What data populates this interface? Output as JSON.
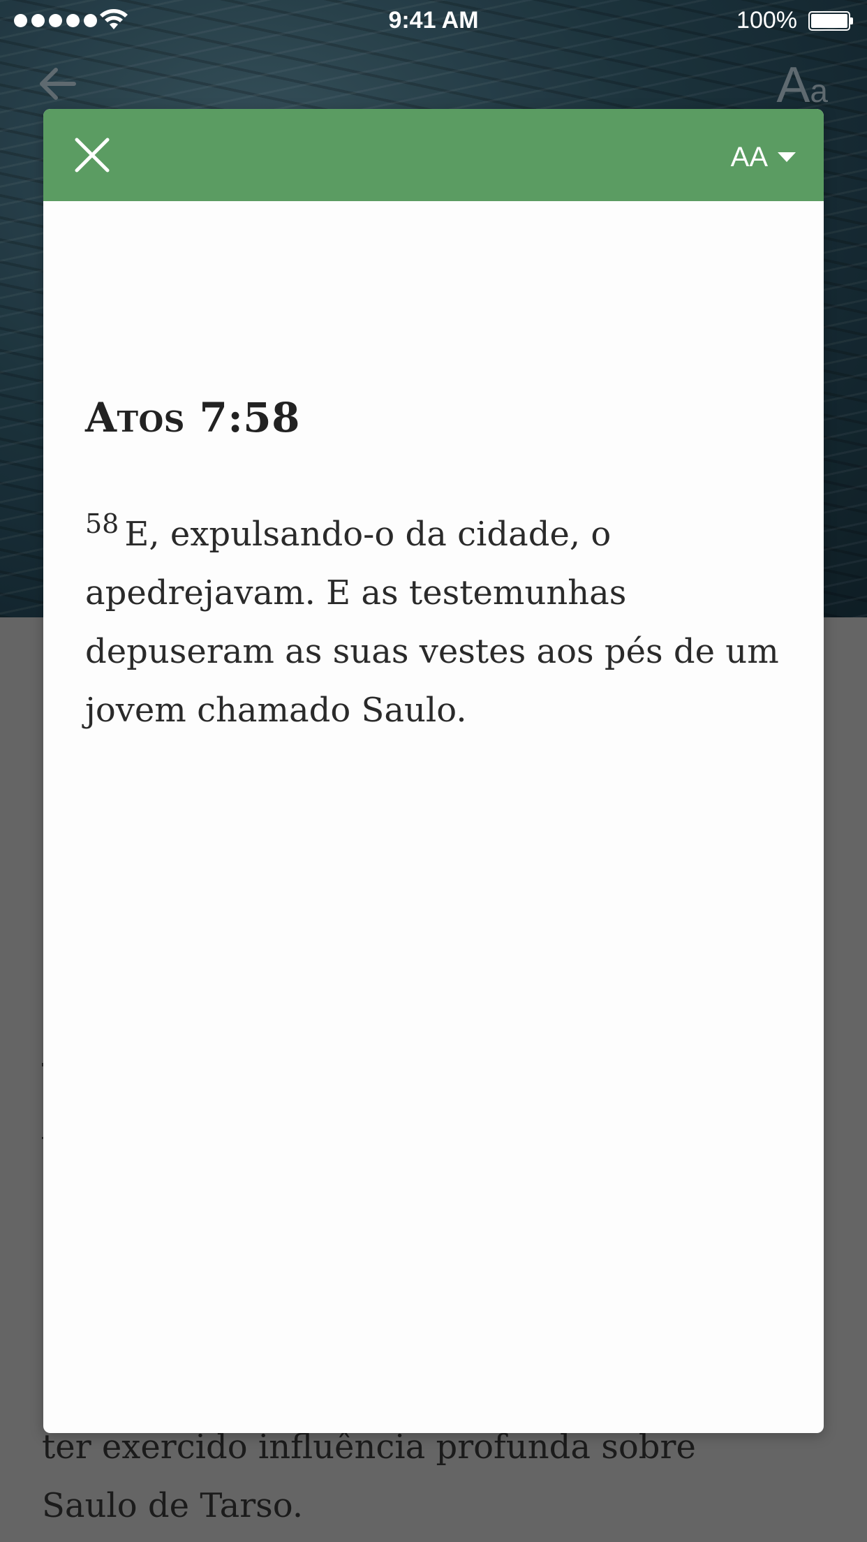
{
  "status_bar": {
    "time": "9:41 AM",
    "battery_percent": "100%",
    "battery_level": 1.0
  },
  "nav": {
    "back_icon": "arrow-left-icon",
    "text_size_icon": {
      "big": "A",
      "small": "a"
    }
  },
  "modal": {
    "close_icon": "close-icon",
    "font_size_label": "AA",
    "dropdown_icon": "caret-down-icon",
    "header_color": "#5b9c62",
    "verse_reference": "Atos 7:58",
    "verse_number": "58",
    "verse_text": "E, expulsando-o da cidade, o apedrejavam. E as testemunhas depuseram as suas vestes aos pés de um jovem chamado Saulo."
  },
  "article": {
    "lines": [
      "ter exercido influência profunda sobre",
      "Saulo de Tarso."
    ]
  }
}
